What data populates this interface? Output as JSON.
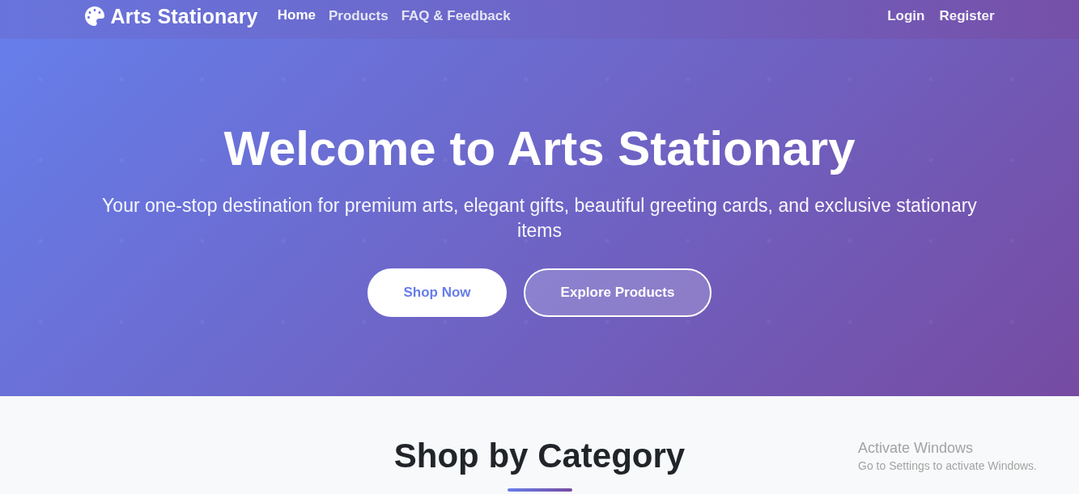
{
  "navbar": {
    "brand": "Arts Stationary",
    "links": [
      {
        "label": "Home",
        "selected": true
      },
      {
        "label": "Products",
        "selected": false
      },
      {
        "label": "FAQ & Feedback",
        "selected": false
      }
    ],
    "auth_links": [
      {
        "label": "Login"
      },
      {
        "label": "Register"
      }
    ]
  },
  "hero": {
    "title": "Welcome to Arts Stationary",
    "subtitle": "Your one-stop destination for premium arts, elegant gifts, beautiful greeting cards, and exclusive stationary items",
    "buttons": [
      {
        "label": "Shop Now",
        "kind": "primary"
      },
      {
        "label": "Explore Products",
        "kind": "outline"
      }
    ]
  },
  "category_section": {
    "title": "Shop by Category"
  },
  "os_watermark": {
    "title": "Activate Windows",
    "subtitle": "Go to Settings to activate Windows."
  }
}
